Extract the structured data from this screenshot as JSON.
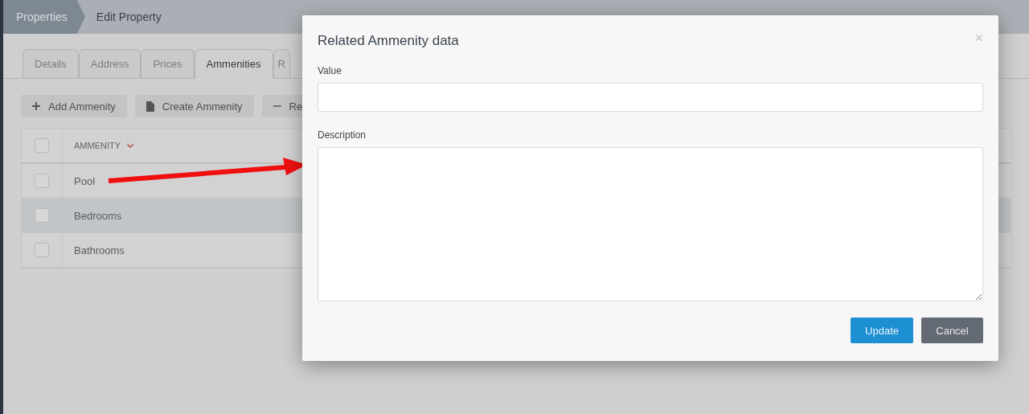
{
  "breadcrumb": [
    {
      "label": "Properties",
      "kind": "parent"
    },
    {
      "label": "Edit Property",
      "kind": "current"
    }
  ],
  "tabs": [
    {
      "label": "Details",
      "selected": false
    },
    {
      "label": "Address",
      "selected": false
    },
    {
      "label": "Prices",
      "selected": false
    },
    {
      "label": "Ammenities",
      "selected": true
    },
    {
      "label": "R",
      "selected": false
    }
  ],
  "toolbar": [
    {
      "label": "Add Ammenity",
      "kind": "add"
    },
    {
      "label": "Create Ammenity",
      "kind": "create"
    },
    {
      "label": "Re",
      "kind": "remove"
    }
  ],
  "table": {
    "header_checked": false,
    "columns": [
      {
        "label": "AMMENITY"
      }
    ],
    "rows": [
      {
        "name": "Pool",
        "checked": false,
        "selected": false
      },
      {
        "name": "Bedrooms",
        "checked": false,
        "selected": true
      },
      {
        "name": "Bathrooms",
        "checked": false,
        "selected": false
      }
    ]
  },
  "modal": {
    "title": "Related Ammenity data",
    "close": "×",
    "fields": [
      {
        "label": "Value",
        "kind": "input"
      },
      {
        "label": "Description",
        "kind": "textarea"
      }
    ],
    "buttons": [
      {
        "label": "Update",
        "kind": "primary"
      },
      {
        "label": "Cancel",
        "kind": "secondary"
      }
    ]
  }
}
